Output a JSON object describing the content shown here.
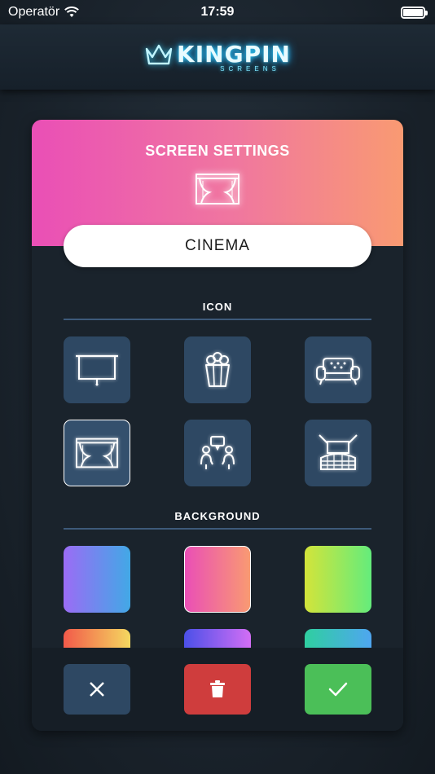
{
  "status_bar": {
    "carrier": "Operatör",
    "time": "17:59",
    "battery_level": 1.0
  },
  "header": {
    "logo_word": "KINGPIN",
    "logo_sub": "SCREENS"
  },
  "settings": {
    "title": "SCREEN SETTINGS",
    "selected_icon": "curtain-stage-icon",
    "screen_name": "CINEMA",
    "icon_section_label": "ICON",
    "background_section_label": "BACKGROUND",
    "icons": [
      {
        "name": "projector-screen-icon",
        "selected": false
      },
      {
        "name": "popcorn-icon",
        "selected": false
      },
      {
        "name": "sofa-icon",
        "selected": false
      },
      {
        "name": "curtain-stage-icon",
        "selected": true
      },
      {
        "name": "people-chat-icon",
        "selected": false
      },
      {
        "name": "theater-seats-icon",
        "selected": false
      }
    ],
    "backgrounds": [
      {
        "from": "#9b6cf5",
        "to": "#42a8e6",
        "selected": false
      },
      {
        "from": "#ea4fb6",
        "to": "#f99a72",
        "selected": true
      },
      {
        "from": "#d3e43a",
        "to": "#64ec7c",
        "selected": false
      },
      {
        "from": "#f25a4a",
        "to": "#f4d860",
        "selected": false
      },
      {
        "from": "#4b50e8",
        "to": "#d36ef5",
        "selected": false
      },
      {
        "from": "#2fcfa0",
        "to": "#4fa6f0",
        "selected": false
      }
    ]
  },
  "actions": {
    "cancel": {
      "icon": "close-icon",
      "color": "#2e4863"
    },
    "delete": {
      "icon": "trash-icon",
      "color": "#cf3d3d"
    },
    "confirm": {
      "icon": "checkmark-icon",
      "color": "#4bbf58"
    }
  }
}
